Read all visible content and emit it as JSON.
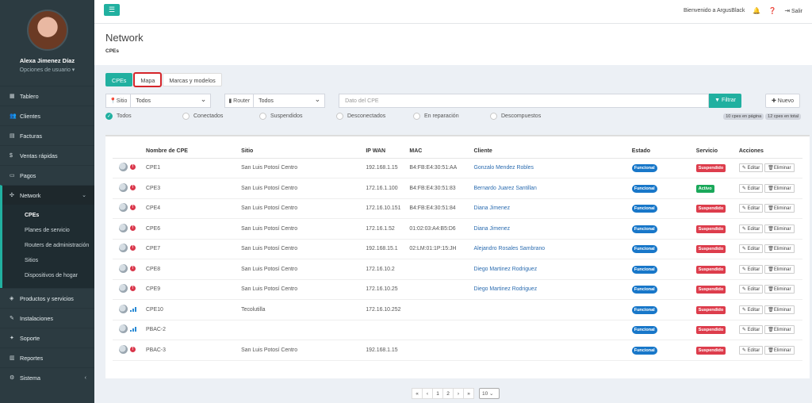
{
  "colors": {
    "accent": "#21b0a0",
    "sidebar": "#2c3b41",
    "link": "#2b6cb0",
    "status_ok": "#1877c9",
    "status_susp": "#dd3d4c",
    "status_active": "#1aa85a",
    "highlight": "#d5252a"
  },
  "user": {
    "name": "Alexa Jimenez Díaz",
    "options": "Opciones de usuario ▾"
  },
  "sidebar": {
    "items": [
      {
        "label": "Tablero",
        "icon": "dashboard-icon"
      },
      {
        "label": "Clientes",
        "icon": "users-icon"
      },
      {
        "label": "Facturas",
        "icon": "invoice-icon"
      },
      {
        "label": "Ventas rápidas",
        "icon": "dollar-icon"
      },
      {
        "label": "Pagos",
        "icon": "payments-icon"
      },
      {
        "label": "Network",
        "icon": "network-icon",
        "chev": "⌄"
      }
    ],
    "sub": [
      "CPEs",
      "Planes de servicio",
      "Routers de administración",
      "Sitios",
      "Dispositivos de hogar"
    ],
    "items2": [
      {
        "label": "Productos y servicios",
        "icon": "tags-icon"
      },
      {
        "label": "Instalaciones",
        "icon": "wrench-icon"
      },
      {
        "label": "Soporte",
        "icon": "support-icon"
      },
      {
        "label": "Reportes",
        "icon": "chart-icon"
      },
      {
        "label": "Sistema",
        "icon": "gears-icon",
        "chev": "‹"
      }
    ]
  },
  "topbar": {
    "menu": "☰",
    "welcome": "Bienvenido a ArgusBlack",
    "logout": "Salir"
  },
  "page": {
    "title": "Network",
    "breadcrumb": "CPEs"
  },
  "tabs": [
    "CPEs",
    "Mapa",
    "Marcas y modelos"
  ],
  "filters": {
    "site_label": "Sitio",
    "site_value": "Todos",
    "router_label": "Router",
    "router_value": "Todos",
    "search_placeholder": "Dato del CPE",
    "filter_btn": "Filtrar",
    "new_btn": "Nuevo"
  },
  "status_filters": [
    "Todos",
    "Conectados",
    "Suspendidos",
    "Desconectados",
    "En reparación",
    "Descompuestos"
  ],
  "counts": [
    "10 cpes en página",
    "12 cpes en total"
  ],
  "table": {
    "headers": [
      "",
      "Nombre de CPE",
      "Sitio",
      "IP WAN",
      "MAC",
      "Cliente",
      "Estado",
      "Servicio",
      "Acciones"
    ],
    "rows": [
      {
        "name": "CPE1",
        "site": "San Luis Potosí Centro",
        "ip": "192.168.1.15",
        "mac": "B4:FB:E4:30:51:AA",
        "client": "Gonzalo Mendez Robles",
        "state": "Funcional",
        "service": "Suspendido",
        "ind": "warn"
      },
      {
        "name": "CPE3",
        "site": "San Luis Potosí Centro",
        "ip": "172.16.1.100",
        "mac": "B4:FB:E4:30:51:83",
        "client": "Bernardo Juarez Santillan",
        "state": "Funcional",
        "service": "Activo",
        "ind": "warn"
      },
      {
        "name": "CPE4",
        "site": "San Luis Potosí Centro",
        "ip": "172.16.10.151",
        "mac": "B4:FB:E4:30:51:84",
        "client": "Diana Jimenez",
        "state": "Funcional",
        "service": "Suspendido",
        "ind": "warn"
      },
      {
        "name": "CPE6",
        "site": "San Luis Potosí Centro",
        "ip": "172.16.1.52",
        "mac": "01:02:03:A4:B5:D6",
        "client": "Diana Jimenez",
        "state": "Funcional",
        "service": "Suspendido",
        "ind": "warn"
      },
      {
        "name": "CPE7",
        "site": "San Luis Potosí Centro",
        "ip": "192.168.15.1",
        "mac": "02:LM:01:1P:15:JH",
        "client": "Alejandro Rosales Sambrano",
        "state": "Funcional",
        "service": "Suspendido",
        "ind": "warn"
      },
      {
        "name": "CPE8",
        "site": "San Luis Potosí Centro",
        "ip": "172.16.10.2",
        "mac": "",
        "client": "Diego Martinez Rodriguez",
        "state": "Funcional",
        "service": "Suspendido",
        "ind": "warn"
      },
      {
        "name": "CPE9",
        "site": "San Luis Potosí Centro",
        "ip": "172.16.10.25",
        "mac": "",
        "client": "Diego Martinez Rodriguez",
        "state": "Funcional",
        "service": "Suspendido",
        "ind": "warn"
      },
      {
        "name": "CPE10",
        "site": "Tecolutilla",
        "ip": "172.16.10.252",
        "mac": "",
        "client": "",
        "state": "Funcional",
        "service": "Suspendido",
        "ind": "signal"
      },
      {
        "name": "PBAC-2",
        "site": "",
        "ip": "",
        "mac": "",
        "client": "",
        "state": "Funcional",
        "service": "Suspendido",
        "ind": "signal"
      },
      {
        "name": "PBAC-3",
        "site": "San Luis Potosí Centro",
        "ip": "192.168.1.15",
        "mac": "",
        "client": "",
        "state": "Funcional",
        "service": "Suspendido",
        "ind": "warn"
      }
    ],
    "edit": "Editar",
    "delete": "Eliminar"
  },
  "pagination": {
    "items": [
      "«",
      "‹",
      "1",
      "2",
      "›",
      "»"
    ],
    "per_page": "10 ⌄"
  }
}
